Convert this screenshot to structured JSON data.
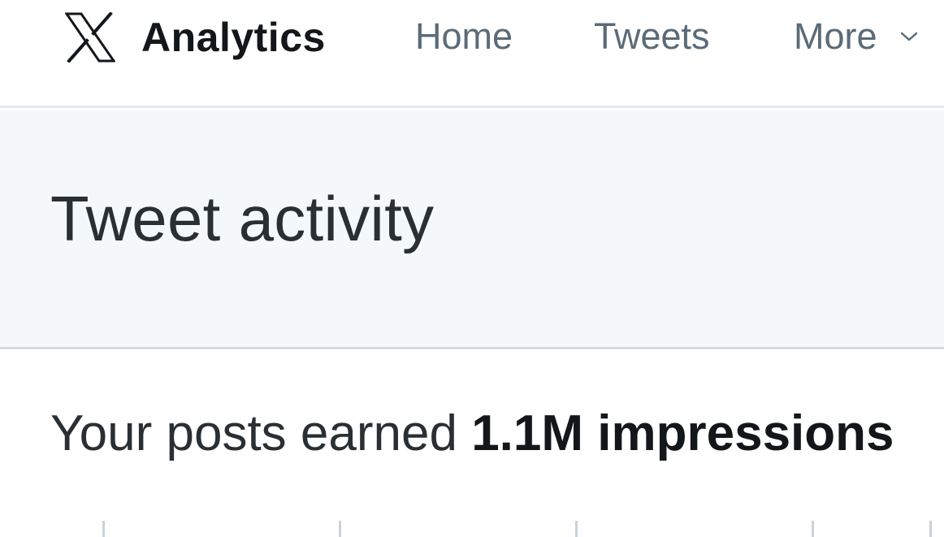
{
  "nav": {
    "brand_name": "Analytics",
    "logo_icon": "x-logo-icon",
    "links": {
      "home": "Home",
      "tweets": "Tweets",
      "more": "More"
    },
    "more_icon": "chevron-down-icon"
  },
  "header": {
    "title": "Tweet activity"
  },
  "summary": {
    "prefix": "Your posts earned ",
    "value": "1.1M impressions"
  },
  "colors": {
    "nav_link": "#5b6b78",
    "header_bg": "#f5f8fa",
    "text": "#292f33"
  }
}
